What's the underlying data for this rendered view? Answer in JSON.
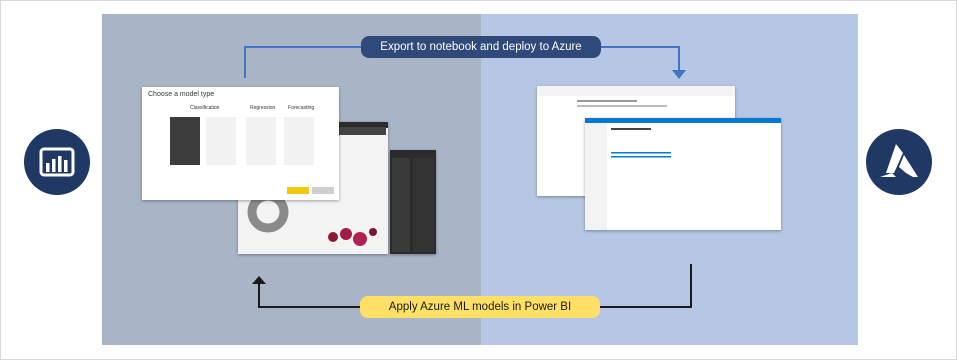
{
  "diagram": {
    "top_label": "Export to notebook and deploy to Azure",
    "bottom_label": "Apply Azure ML models in Power BI"
  },
  "powerbi_dialog": {
    "title": "Choose a model type",
    "columns": [
      "Classification",
      "Regression",
      "Forecasting"
    ]
  },
  "colors": {
    "left_panel": "#a9b5c7",
    "right_panel": "#b6c7e6",
    "logo_circle": "#1f3864",
    "top_pill": "#2f4a7a",
    "bottom_pill": "#ffe066",
    "arrow_top": "#4472c4",
    "arrow_bottom": "#1a1a1a"
  },
  "icons": {
    "left_logo": "power-bi-logo-icon",
    "right_logo": "azure-logo-icon"
  }
}
